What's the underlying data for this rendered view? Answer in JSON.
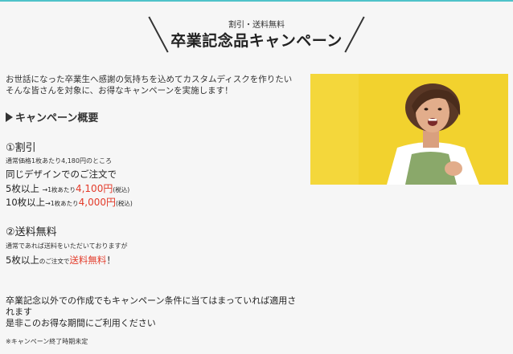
{
  "header": {
    "subtitle": "割引・送料無料",
    "title": "卒業記念品キャンペーン"
  },
  "intro": {
    "line1": "お世話になった卒業生へ感謝の気持ちを込めてカスタムディスクを作りたい",
    "line2": "そんな皆さんを対象に、お得なキャンペーンを実施します！"
  },
  "overview_label": "キャンペーン概要",
  "discount": {
    "title": "①割引",
    "regular_price_note": "通常価格1枚あたり4,180円のところ",
    "same_design": "同じデザインでのご注文で",
    "tier1_qty": "5枚以上",
    "tier1_arrow": "→",
    "tier1_per": "1枚あたり",
    "tier1_price": "4,100円",
    "tier1_tax": "(税込)",
    "tier2_qty": "10枚以上",
    "tier2_arrow": "→",
    "tier2_per": "1枚あたり",
    "tier2_price": "4,000円",
    "tier2_tax": "(税込)"
  },
  "shipping": {
    "title": "②送料無料",
    "note": "通常であれば送料をいただいておりますが",
    "qty": "5枚以上",
    "order_text": "のご注文で",
    "free": "送料無料",
    "exclaim": "！"
  },
  "footer": {
    "line1": "卒業記念以外での作成でもキャンペーン条件に当てはまっていれば適用さ",
    "line2": "れます",
    "line3": "是非このお得な期間にご利用ください",
    "note": "※キャンペーン終了時期未定"
  },
  "colors": {
    "accent_red": "#e33b2a",
    "photo_bg": "#f2d22e",
    "top_line": "#4fc3c9"
  }
}
